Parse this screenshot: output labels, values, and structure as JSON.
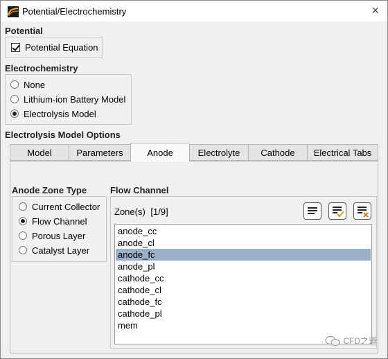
{
  "window": {
    "title": "Potential/Electrochemistry",
    "close_glyph": "×"
  },
  "potential": {
    "heading": "Potential",
    "checkbox_label": "Potential Equation",
    "checked": true
  },
  "electrochemistry": {
    "heading": "Electrochemistry",
    "options": [
      "None",
      "Lithium-ion Battery Model",
      "Electrolysis Model"
    ],
    "selected": "Electrolysis Model"
  },
  "electrolysis": {
    "heading": "Electrolysis Model Options",
    "tabs": [
      "Model",
      "Parameters",
      "Anode",
      "Electrolyte",
      "Cathode",
      "Electrical Tabs"
    ],
    "active_tab": "Anode"
  },
  "anode_zone_type": {
    "heading": "Anode Zone Type",
    "options": [
      "Current Collector",
      "Flow Channel",
      "Porous Layer",
      "Catalyst Layer"
    ],
    "selected": "Flow Channel"
  },
  "flow_channel": {
    "heading": "Flow Channel",
    "zones_label": "Zone(s)",
    "zones_count": "[1/9]",
    "toolbar_icons": [
      "select-all-icon",
      "select-checked-icon",
      "deselect-icon"
    ],
    "zones": [
      "anode_cc",
      "anode_cl",
      "anode_fc",
      "anode_pl",
      "cathode_cc",
      "cathode_cl",
      "cathode_fc",
      "cathode_pl",
      "mem"
    ],
    "selected_zone": "anode_fc"
  },
  "watermark": {
    "text": "CFD之道"
  },
  "colors": {
    "selection": "#9ab0c6",
    "check_accent": "#d4a20a",
    "clear_accent": "#c8860a"
  }
}
